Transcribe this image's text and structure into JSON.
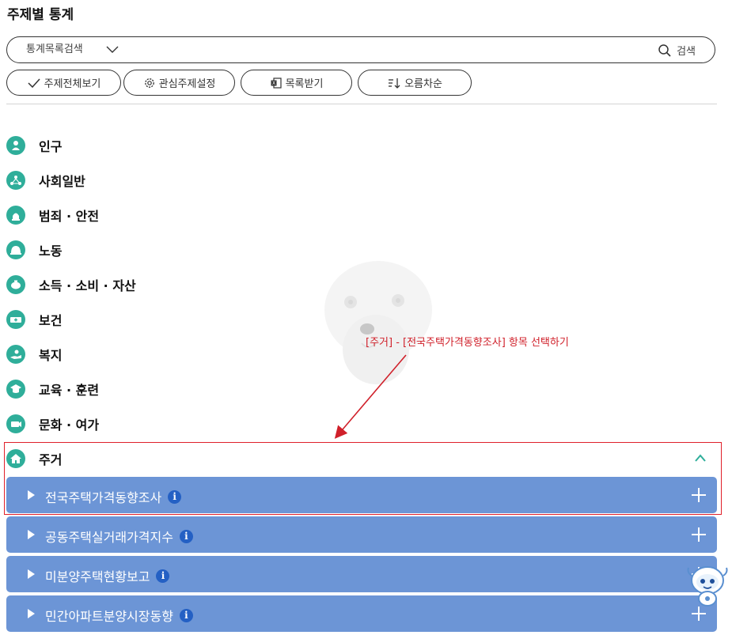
{
  "page": {
    "title": "주제별 통계"
  },
  "search": {
    "placeholder": "통계목록검색",
    "button_label": "검색"
  },
  "toolbar": {
    "view_all_label": "주제전체보기",
    "interest_label": "관심주제설정",
    "download_label": "목록받기",
    "sort_label": "오름차순"
  },
  "categories": [
    {
      "label": "인구",
      "icon": "people-icon"
    },
    {
      "label": "사회일반",
      "icon": "network-icon"
    },
    {
      "label": "범죄 · 안전",
      "icon": "siren-icon"
    },
    {
      "label": "노동",
      "icon": "helmet-icon"
    },
    {
      "label": "소득 · 소비 · 자산",
      "icon": "piggy-bank-icon"
    },
    {
      "label": "보건",
      "icon": "ambulance-icon"
    },
    {
      "label": "복지",
      "icon": "care-hand-icon"
    },
    {
      "label": "교육 · 훈련",
      "icon": "graduation-cap-icon"
    },
    {
      "label": "문화 · 여가",
      "icon": "camera-icon"
    },
    {
      "label": "주거",
      "icon": "house-icon"
    }
  ],
  "housing_items": [
    {
      "label": "전국주택가격동향조사"
    },
    {
      "label": "공동주택실거래가격지수"
    },
    {
      "label": "미분양주택현황보고"
    },
    {
      "label": "민간아파트분양시장동향"
    }
  ],
  "annotation": {
    "text": "[주거] - [전국주택가격동향조사] 항목 선택하기"
  },
  "colors": {
    "category_icon": "#2fae9a",
    "sub_item_bg": "#6c95d6",
    "highlight": "#e0202a"
  }
}
